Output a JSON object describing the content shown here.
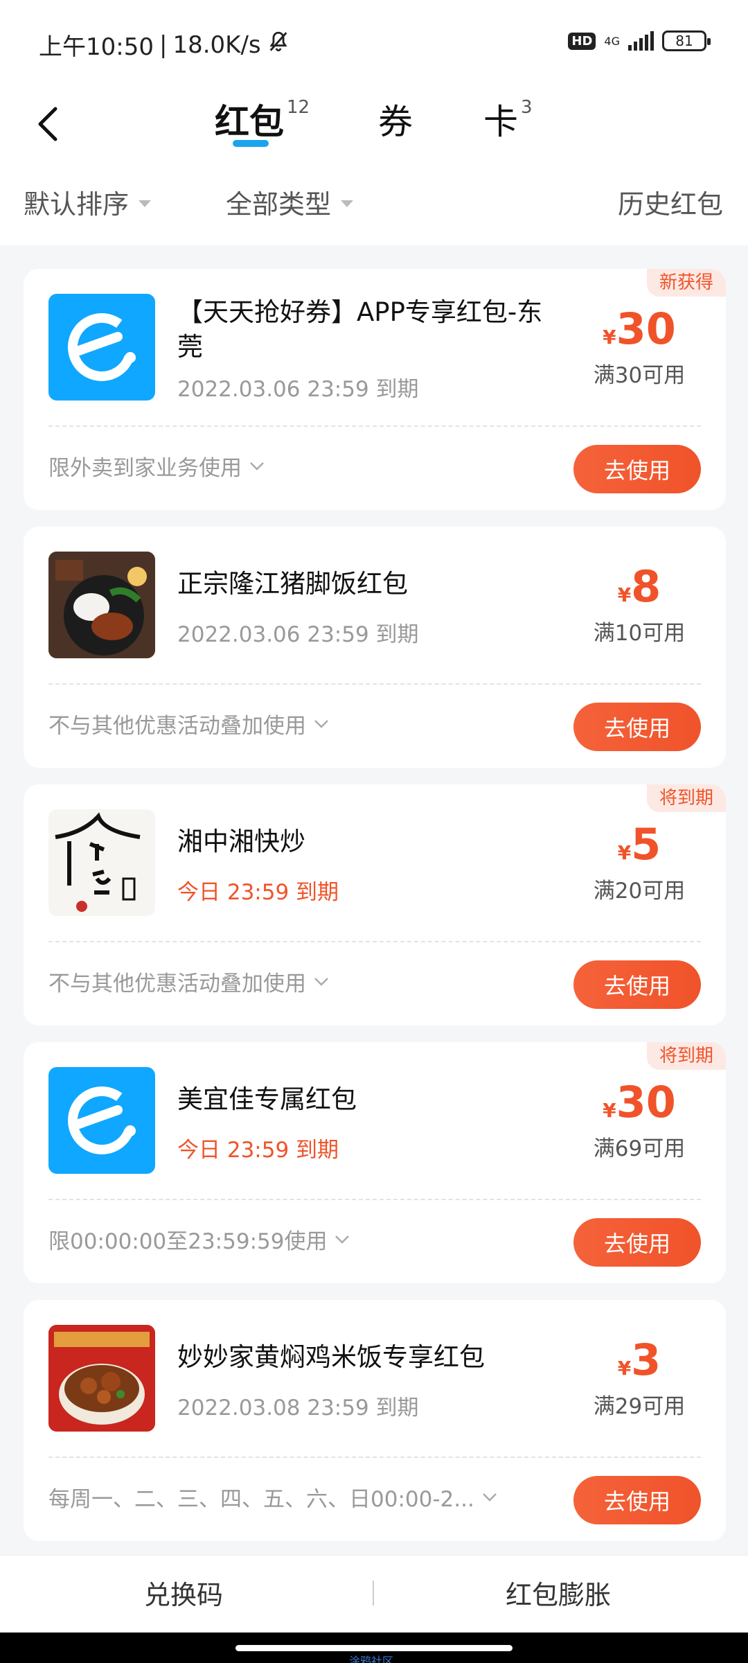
{
  "status": {
    "time": "上午10:50",
    "speed": "18.0K/s",
    "hd": "HD",
    "network": "4G",
    "battery": "81"
  },
  "tabs": [
    {
      "label": "红包",
      "count": "12"
    },
    {
      "label": "券",
      "count": ""
    },
    {
      "label": "卡",
      "count": "3"
    }
  ],
  "filters": {
    "sort": "默认排序",
    "type": "全部类型",
    "history": "历史红包"
  },
  "cards": [
    {
      "badge": "新获得",
      "title": "【天天抢好券】APP专享红包-东莞",
      "expiry": "2022.03.06 23:59 到期",
      "currency": "¥",
      "amount": "30",
      "condition": "满30可用",
      "rule": "限外卖到家业务使用",
      "button": "去使用"
    },
    {
      "badge": "",
      "title": "正宗隆江猪脚饭红包",
      "expiry": "2022.03.06 23:59 到期",
      "currency": "¥",
      "amount": "8",
      "condition": "满10可用",
      "rule": "不与其他优惠活动叠加使用",
      "button": "去使用"
    },
    {
      "badge": "将到期",
      "title": "湘中湘快炒",
      "expiry": "今日 23:59 到期",
      "currency": "¥",
      "amount": "5",
      "condition": "满20可用",
      "rule": "不与其他优惠活动叠加使用",
      "button": "去使用"
    },
    {
      "badge": "将到期",
      "title": "美宜佳专属红包",
      "expiry": "今日 23:59 到期",
      "currency": "¥",
      "amount": "30",
      "condition": "满69可用",
      "rule": "限00:00:00至23:59:59使用",
      "button": "去使用"
    },
    {
      "badge": "",
      "title": "妙妙家黄焖鸡米饭专享红包",
      "expiry": "2022.03.08 23:59 到期",
      "currency": "¥",
      "amount": "3",
      "condition": "满29可用",
      "rule": "每周一、二、三、四、五、六、日00:00-2...",
      "button": "去使用"
    }
  ],
  "bottom": {
    "redeem": "兑换码",
    "expand": "红包膨胀"
  },
  "watermark": "涂鸦社区"
}
